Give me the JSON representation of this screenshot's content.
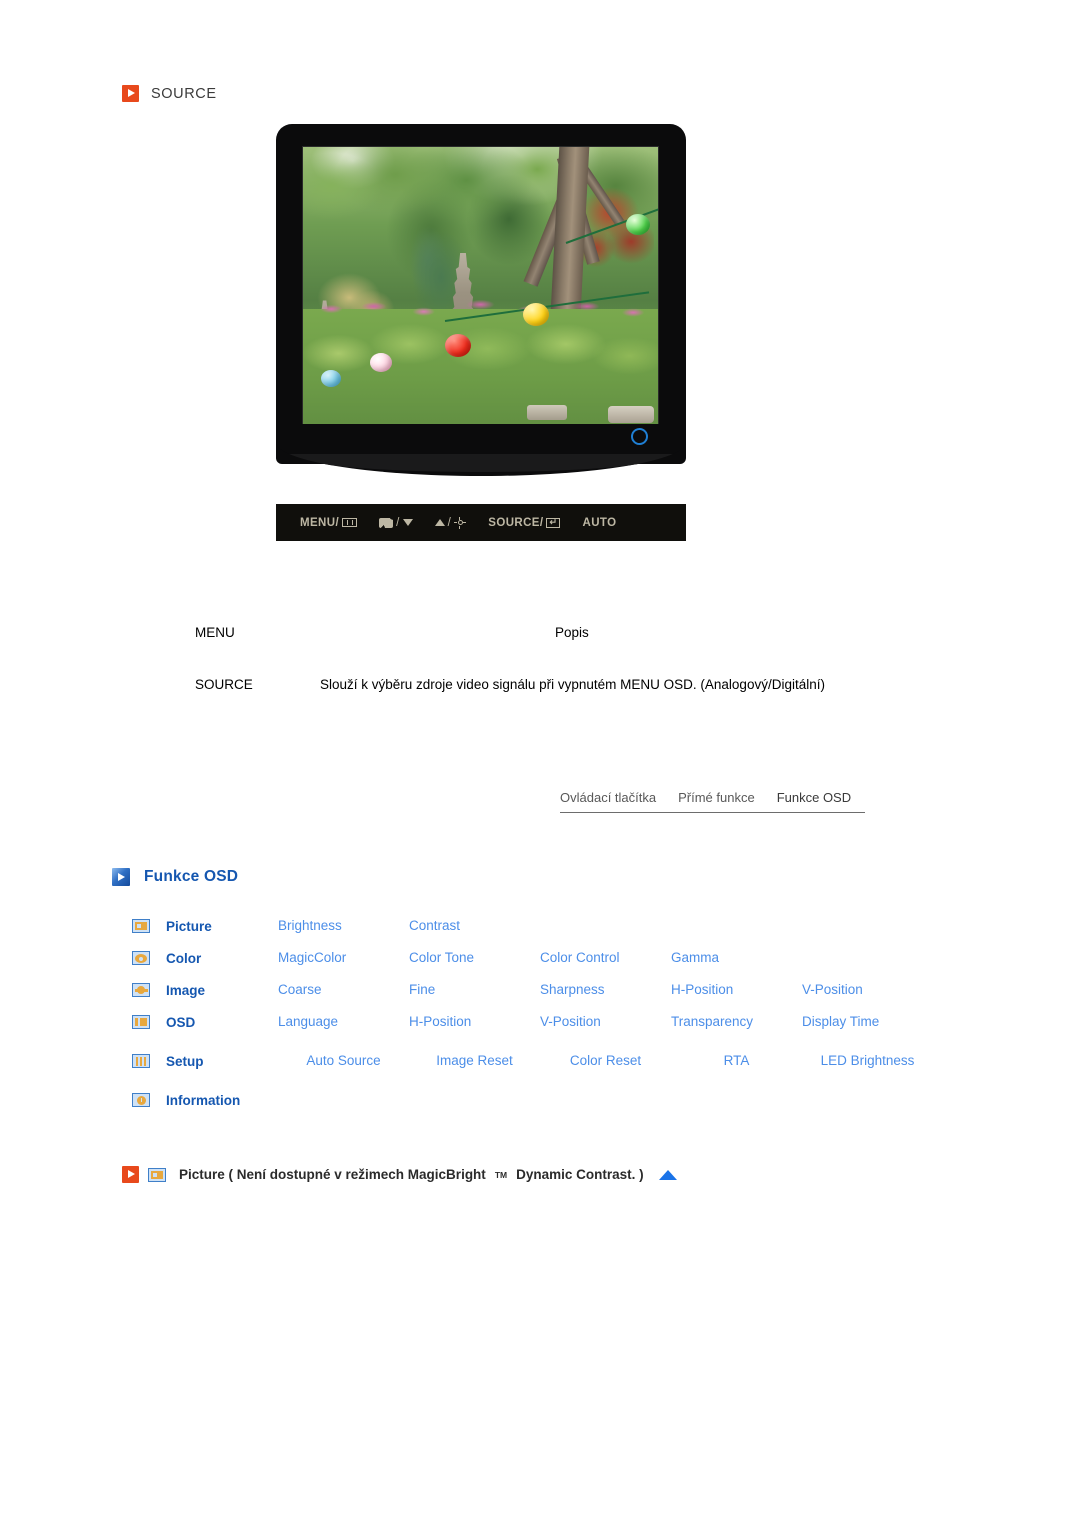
{
  "section": {
    "icon": "play-square-icon",
    "title": "SOURCE"
  },
  "monitor": {
    "alt": "Samsung LCD monitor front view showing a garden photo with stone pagodas and paper lanterns",
    "control_buttons": [
      {
        "label": "MENU/",
        "icon": "menu-grid-icon"
      },
      {
        "label": "",
        "icon": "magicbright-icon",
        "sep": "/",
        "icon2": "arrow-down-icon"
      },
      {
        "label": "",
        "icon": "arrow-up-icon",
        "sep": "/",
        "icon2": "brightness-sun-icon"
      },
      {
        "label": "SOURCE/",
        "icon": "enter-icon"
      },
      {
        "label": "AUTO",
        "icon": ""
      }
    ],
    "power_led": "power-led-indicator"
  },
  "desc_table": {
    "head_menu": "MENU",
    "head_popis": "Popis",
    "rows": [
      {
        "key": "SOURCE",
        "value": "Slouží k výběru zdroje video signálu při vypnutém MENU OSD. (Analogový/Digitální)"
      }
    ]
  },
  "tabs": [
    {
      "label": "Ovládací tlačítka"
    },
    {
      "label": "Přímé funkce"
    },
    {
      "label": "Funkce OSD"
    }
  ],
  "osd_heading": {
    "icon": "play-square-blue-icon",
    "title": "Funkce OSD"
  },
  "osd_grid": {
    "rows": [
      {
        "icon": "picture-icon",
        "category": "Picture",
        "items": [
          "Brightness",
          "Contrast",
          "",
          "",
          ""
        ]
      },
      {
        "icon": "color-icon",
        "category": "Color",
        "items": [
          "MagicColor",
          "Color Tone",
          "Color Control",
          "Gamma",
          ""
        ]
      },
      {
        "icon": "image-icon",
        "category": "Image",
        "items": [
          "Coarse",
          "Fine",
          "Sharpness",
          "H-Position",
          "V-Position"
        ]
      },
      {
        "icon": "osd-icon",
        "category": "OSD",
        "items": [
          "Language",
          "H-Position",
          "V-Position",
          "Transparency",
          "Display Time"
        ]
      },
      {
        "icon": "setup-icon",
        "category": "Setup",
        "items": [
          "Auto Source",
          "Image Reset",
          "Color Reset",
          "RTA",
          "LED Brightness"
        ]
      },
      {
        "icon": "information-icon",
        "category": "Information",
        "items": [
          "",
          "",
          "",
          "",
          ""
        ]
      }
    ]
  },
  "note": {
    "icon_red": "play-square-icon",
    "icon_picture": "picture-icon",
    "text_before": "Picture ( Není dostupné v režimech MagicBright",
    "superscript": "TM",
    "text_after": " Dynamic Contrast. )",
    "scroll_icon": "arrow-up-blue-icon"
  },
  "colors": {
    "accent_red": "#e8491c",
    "accent_blue": "#1557b0",
    "link_blue": "#4c8ee8",
    "icon_orange": "#e89c2c",
    "bezel": "#0b0b0c",
    "led_blue": "#1f7fd4"
  }
}
